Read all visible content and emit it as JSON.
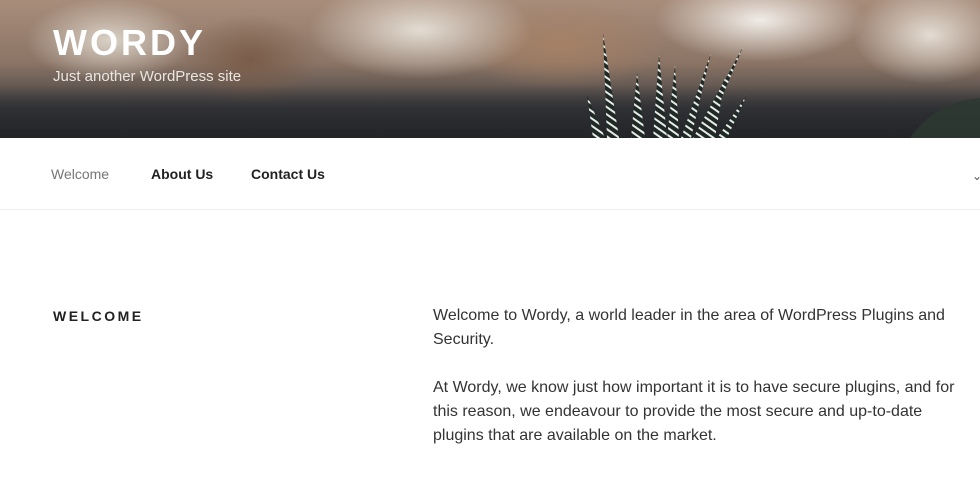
{
  "site": {
    "title": "WORDY",
    "tagline": "Just another WordPress site"
  },
  "nav": {
    "items": [
      {
        "label": "Welcome",
        "current": true
      },
      {
        "label": "About Us",
        "current": false
      },
      {
        "label": "Contact Us",
        "current": false
      }
    ],
    "scroll_icon": "chevron-down-icon"
  },
  "page": {
    "heading": "WELCOME",
    "paragraphs": [
      "Welcome to Wordy, a world leader in the area of WordPress Plugins and Security.",
      "At Wordy, we know just how important it is to have secure plugins, and for this reason, we endeavour to provide the most secure and up-to-date plugins that are available on the market."
    ]
  },
  "colors": {
    "title": "#ffffff",
    "nav_current": "#767676",
    "text": "#333333"
  }
}
